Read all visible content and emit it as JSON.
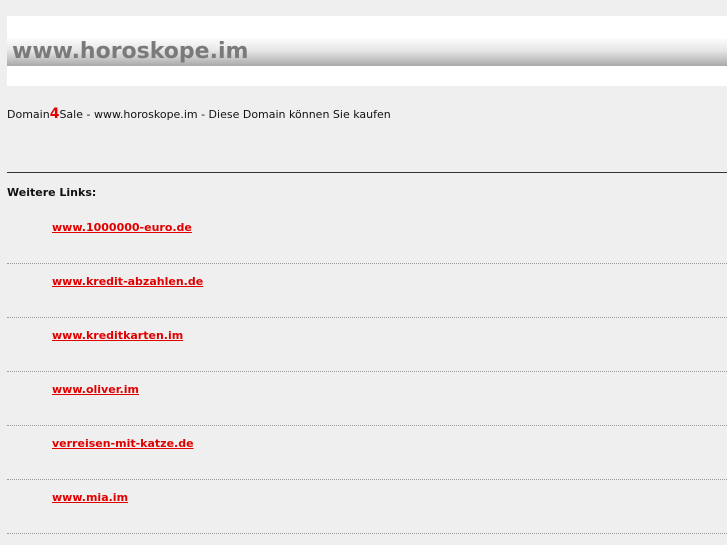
{
  "header": {
    "site_title": "www.horoskope.im"
  },
  "sale": {
    "prefix": "Domain",
    "four": "4",
    "suffix": "Sale - www.horoskope.im - Diese Domain können Sie kaufen"
  },
  "links": {
    "heading": "Weitere Links:",
    "items": [
      {
        "label": "www.1000000-euro.de"
      },
      {
        "label": "www.kredit-abzahlen.de"
      },
      {
        "label": "www.kreditkarten.im"
      },
      {
        "label": "www.oliver.im"
      },
      {
        "label": "verreisen-mit-katze.de"
      },
      {
        "label": "www.mia.im"
      }
    ]
  },
  "colors": {
    "background": "#efefef",
    "link": "#e00000",
    "title": "#7a7a7a",
    "accent_four": "#e00000"
  }
}
